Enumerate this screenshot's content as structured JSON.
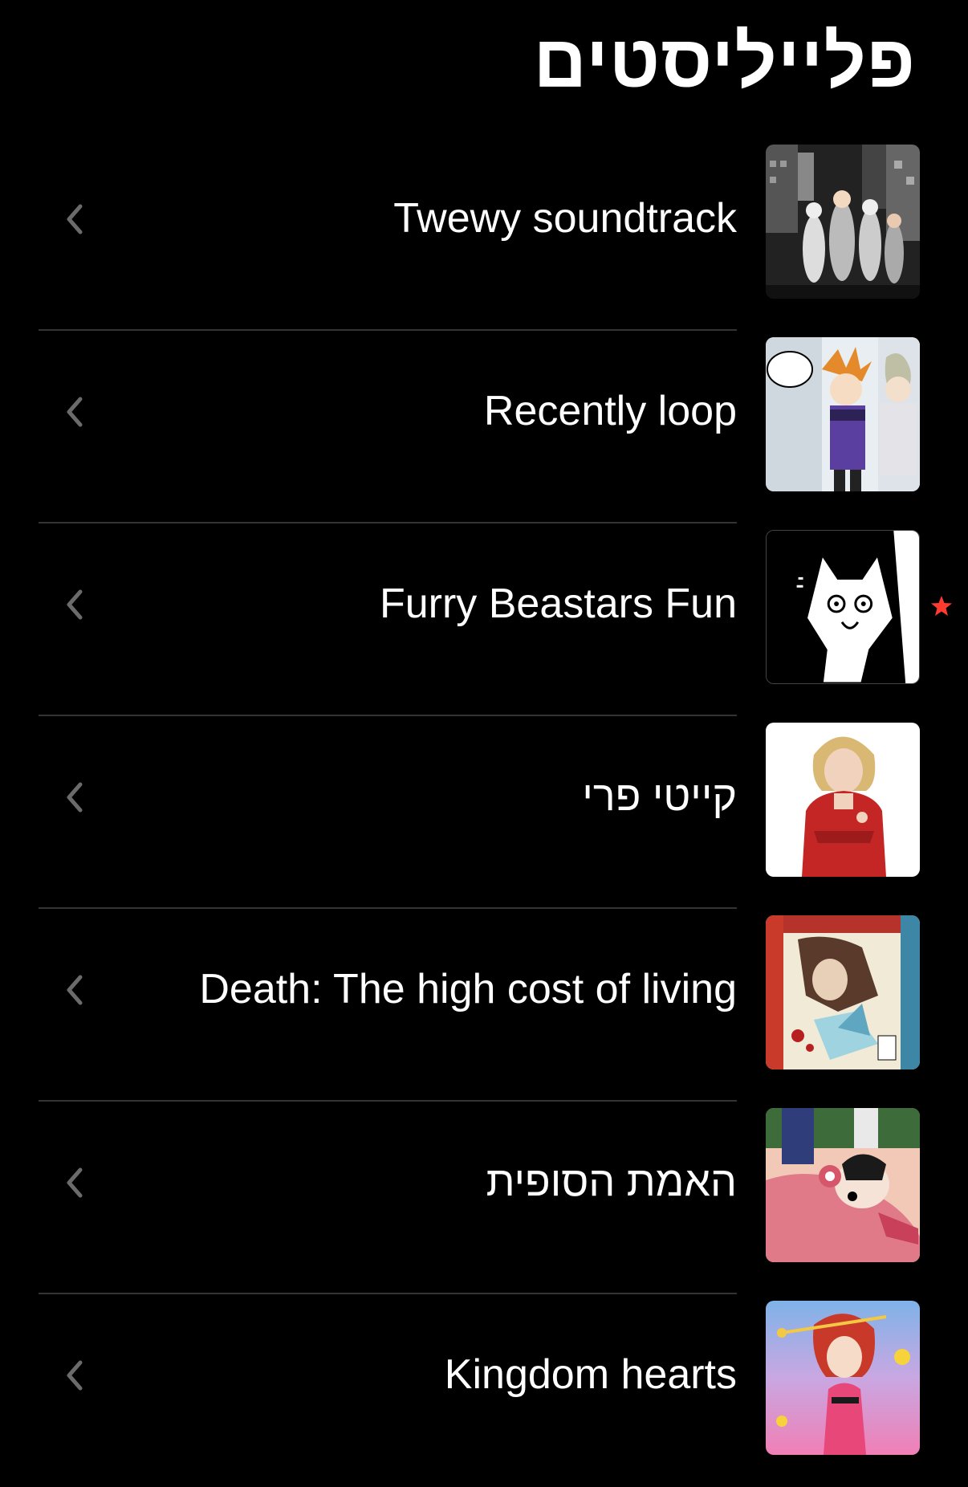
{
  "header": {
    "title": "פלייליסטים"
  },
  "colors": {
    "background": "#000000",
    "text": "#ffffff",
    "divider": "#333333",
    "chevron": "#6b6b6b",
    "star": "#ff3b30"
  },
  "playlists": [
    {
      "title": "Twewy soundtrack",
      "artwork": "twewy-group-artwork",
      "starred": false
    },
    {
      "title": "Recently loop",
      "artwork": "twewy-neku-joshua-artwork",
      "starred": false
    },
    {
      "title": "Furry Beastars Fun",
      "artwork": "beastars-legosi-artwork",
      "starred": true
    },
    {
      "title": "קייטי פרי",
      "artwork": "katy-perry-portrait",
      "starred": false
    },
    {
      "title": "Death: The high cost of living",
      "artwork": "runaways-comic-cover",
      "starred": false
    },
    {
      "title": "האמת הסופית",
      "artwork": "manga-artwork",
      "starred": false
    },
    {
      "title": "Kingdom hearts",
      "artwork": "kingdom-hearts-kairi-artwork",
      "starred": false
    }
  ]
}
